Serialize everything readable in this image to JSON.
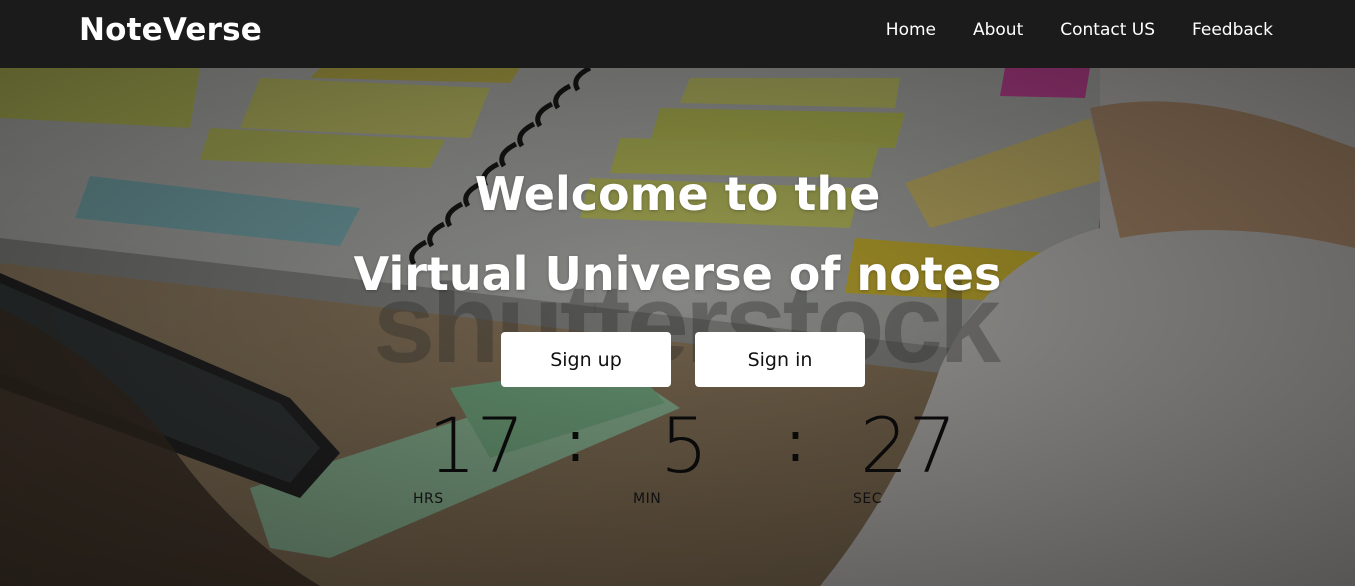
{
  "navbar": {
    "brand": "NoteVerse",
    "links": [
      "Home",
      "About",
      "Contact US",
      "Feedback"
    ]
  },
  "hero": {
    "title_line1": "Welcome to the",
    "title_line2": "Virtual Universe of notes",
    "watermark": "shutterstock",
    "buttons": {
      "signup": "Sign up",
      "signin": "Sign in"
    }
  },
  "countdown": {
    "hours": "17",
    "minutes": "5",
    "seconds": "27",
    "separator": ":",
    "labels": {
      "hours": "HRS",
      "minutes": "MIN",
      "seconds": "SEC"
    }
  },
  "colors": {
    "navbar_bg": "#1b1b1b",
    "title_text": "#ffffff",
    "button_bg": "#ffffff",
    "countdown_text": "#0a0a0a"
  }
}
